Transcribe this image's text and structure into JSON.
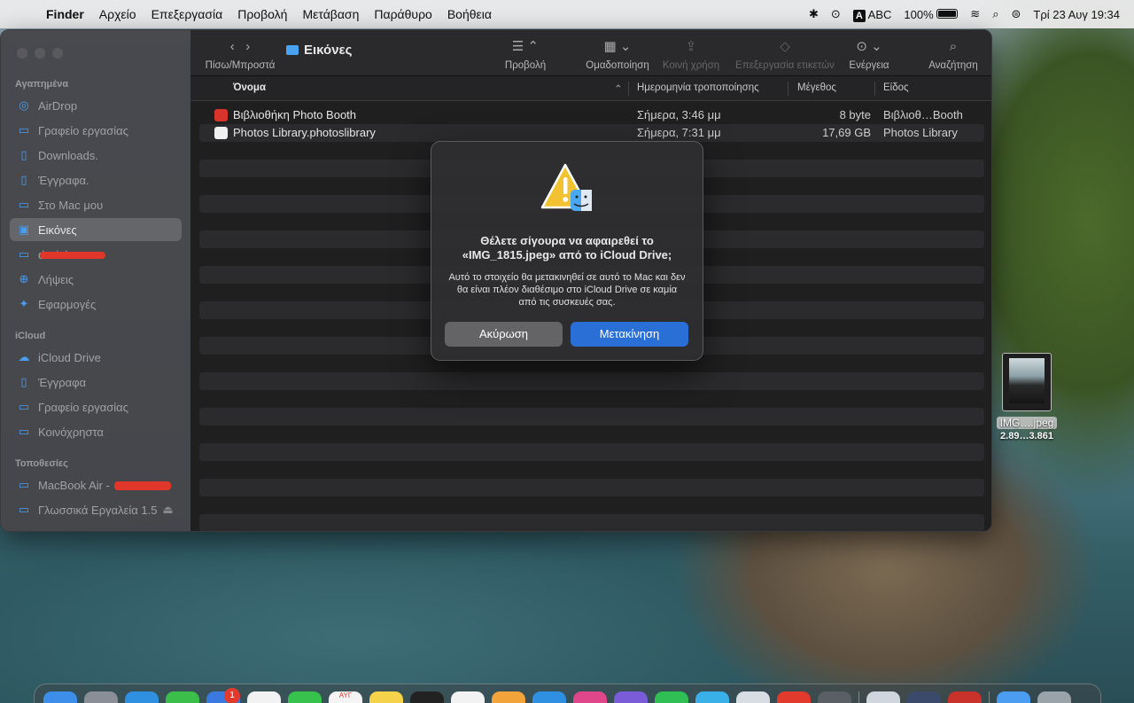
{
  "menubar": {
    "app_name": "Finder",
    "menus": [
      "Αρχείο",
      "Επεξεργασία",
      "Προβολή",
      "Μετάβαση",
      "Παράθυρο",
      "Βοήθεια"
    ],
    "input_source": "A",
    "input_label": "ABC",
    "battery": "100%",
    "clock": "Τρί 23 Αυγ  19:34"
  },
  "window": {
    "title": "Εικόνες",
    "toolbar": {
      "nav_label": "Πίσω/Μπροστά",
      "view_label": "Προβολή",
      "group_label": "Ομαδοποίηση",
      "share_label": "Κοινή χρήση",
      "tags_label": "Επεξεργασία ετικετών",
      "action_label": "Ενέργεια",
      "search_label": "Αναζήτηση"
    },
    "columns": {
      "name": "Όνομα",
      "date": "Ημερομηνία τροποποίησης",
      "size": "Μέγεθος",
      "kind": "Είδος"
    },
    "files": [
      {
        "name": "Βιβλιοθήκη Photo Booth",
        "date": "Σήμερα, 3:46 μμ",
        "size": "8 byte",
        "kind": "Βιβλιοθ…Booth",
        "icon_color": "#d8342c"
      },
      {
        "name": "Photos Library.photoslibrary",
        "date": "Σήμερα, 7:31 μμ",
        "size": "17,69 GB",
        "kind": "Photos Library",
        "icon_color": "#f0f0f0"
      }
    ]
  },
  "sidebar": {
    "favorites_title": "Αγαπημένα",
    "favorites": [
      {
        "label": "AirDrop",
        "icon": "airdrop-icon"
      },
      {
        "label": "Γραφείο εργασίας",
        "icon": "desktop-icon"
      },
      {
        "label": "Downloads.",
        "icon": "doc-icon"
      },
      {
        "label": "Έγγραφα.",
        "icon": "doc-icon"
      },
      {
        "label": "Στο Mac μου",
        "icon": "folder-icon"
      },
      {
        "label": "Εικόνες",
        "icon": "pictures-icon"
      },
      {
        "label": "d…ials",
        "icon": "folder-icon"
      },
      {
        "label": "Λήψεις",
        "icon": "download-icon"
      },
      {
        "label": "Εφαρμογές",
        "icon": "apps-icon"
      }
    ],
    "icloud_title": "iCloud",
    "icloud": [
      {
        "label": "iCloud Drive",
        "icon": "cloud-icon"
      },
      {
        "label": "Έγγραφα",
        "icon": "doc-icon"
      },
      {
        "label": "Γραφείο εργασίας",
        "icon": "desktop-icon"
      },
      {
        "label": "Κοινόχρηστα",
        "icon": "shared-folder-icon"
      }
    ],
    "locations_title": "Τοποθεσίες",
    "locations": [
      {
        "label": "MacBook Air -",
        "icon": "laptop-icon"
      },
      {
        "label": "Γλωσσικά Εργαλεία 1.5",
        "icon": "disk-icon"
      }
    ]
  },
  "dialog": {
    "title": "Θέλετε σίγουρα να αφαιρεθεί το «IMG_1815.jpeg» από το iCloud Drive;",
    "message": "Αυτό το στοιχείο θα μετακινηθεί σε αυτό το Mac και δεν θα είναι πλέον διαθέσιμο στο iCloud Drive σε καμία από τις συσκευές σας.",
    "cancel_label": "Ακύρωση",
    "confirm_label": "Μετακίνηση"
  },
  "desktop_file": {
    "name": "IMG….jpeg",
    "subtitle": "2.89…3.861"
  },
  "dock": {
    "badge": "1",
    "calendar_month": "ΑΥΓ"
  }
}
